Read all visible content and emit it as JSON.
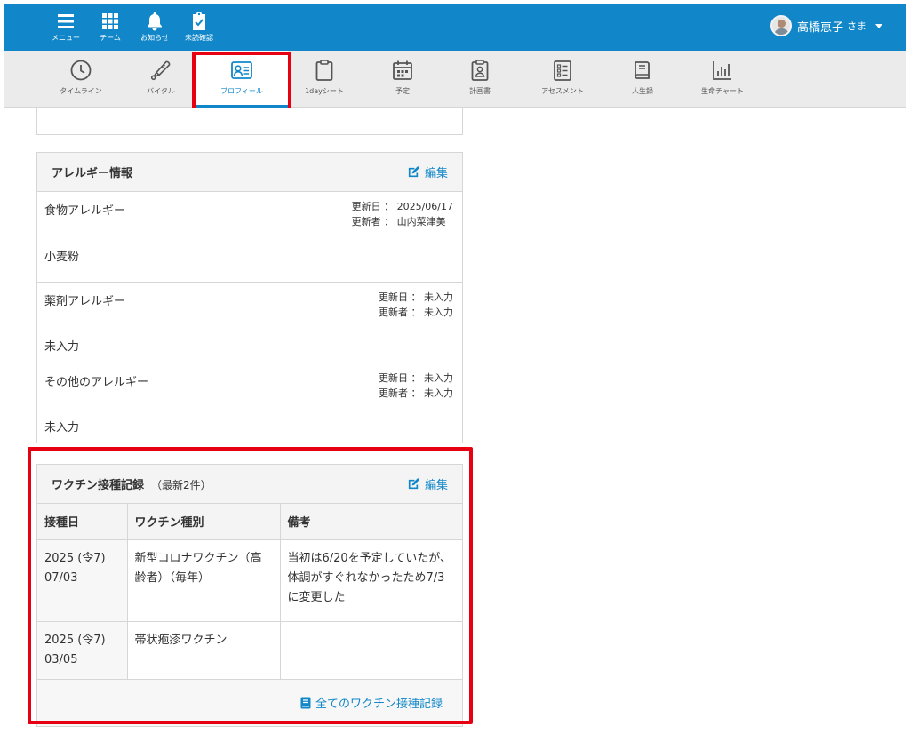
{
  "topnav": [
    {
      "label": "メニュー",
      "icon": "menu-icon"
    },
    {
      "label": "チーム",
      "icon": "grid-icon"
    },
    {
      "label": "お知らせ",
      "icon": "bell-icon"
    },
    {
      "label": "未読確認",
      "icon": "clipboard-check-icon"
    }
  ],
  "user": {
    "name": "高橋恵子",
    "suffix": "さま"
  },
  "tabs": [
    {
      "label": "タイムライン",
      "icon": "clock-icon"
    },
    {
      "label": "バイタル",
      "icon": "thermometer-icon"
    },
    {
      "label": "プロフィール",
      "icon": "profile-card-icon",
      "active": true
    },
    {
      "label": "1dayシート",
      "icon": "clipboard-icon"
    },
    {
      "label": "予定",
      "icon": "calendar-icon"
    },
    {
      "label": "計画書",
      "icon": "badge-icon"
    },
    {
      "label": "アセスメント",
      "icon": "checklist-icon"
    },
    {
      "label": "人生録",
      "icon": "book-icon"
    },
    {
      "label": "生命チャート",
      "icon": "bar-chart-icon"
    }
  ],
  "allergy": {
    "title": "アレルギー情報",
    "edit_label": "編集",
    "items": [
      {
        "label": "食物アレルギー",
        "updated": "更新日 ： 2025/06/17",
        "updater": "更新者 ： 山内菜津美",
        "value": "小麦粉"
      },
      {
        "label": "薬剤アレルギー",
        "updated": "更新日 ： 未入力",
        "updater": "更新者 ： 未入力",
        "value": "未入力"
      },
      {
        "label": "その他のアレルギー",
        "updated": "更新日 ： 未入力",
        "updater": "更新者 ： 未入力",
        "value": "未入力"
      }
    ]
  },
  "vaccine": {
    "title": "ワクチン接種記録",
    "subtitle": "（最新2件）",
    "edit_label": "編集",
    "columns": [
      "接種日",
      "ワクチン種別",
      "備考"
    ],
    "rows": [
      {
        "date1": "2025 (令7)",
        "date2": "07/03",
        "type": "新型コロナワクチン（高齢者）（毎年）",
        "note": "当初は6/20を予定していたが、体調がすぐれなかったため7/3に変更した"
      },
      {
        "date1": "2025 (令7)",
        "date2": "03/05",
        "type": "帯状疱疹ワクチン",
        "note": ""
      }
    ],
    "footer_link": "全てのワクチン接種記録"
  },
  "colors": {
    "header_blue": "#1187c9",
    "highlight_red": "#e60012"
  }
}
